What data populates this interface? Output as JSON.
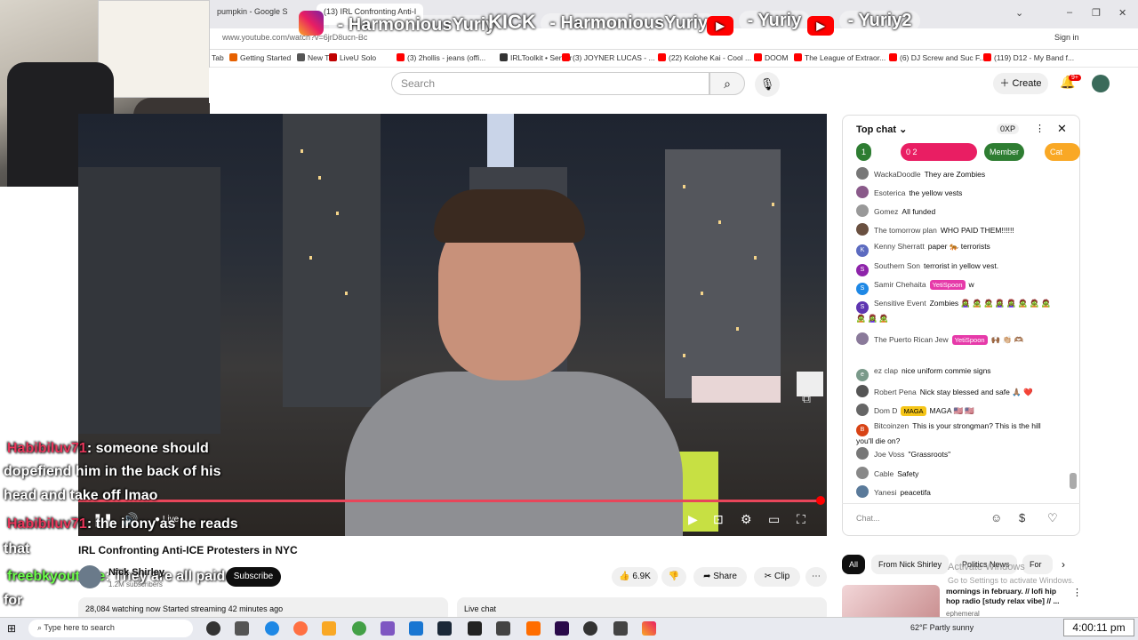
{
  "browser": {
    "tabs": [
      "pumpkin - Google S",
      "(13) IRL Confronting Anti-I"
    ],
    "url": "www.youtube.com/watch?v=6jrD8ucn-Bc",
    "sign_in": "Sign in",
    "bookmarks": [
      {
        "label": "Tab",
        "color": ""
      },
      {
        "label": "Getting Started",
        "color": "#e66000"
      },
      {
        "label": "New Tab",
        "color": "#555555"
      },
      {
        "label": "LiveU Solo",
        "color": "#c00000"
      },
      {
        "label": "(3) 2hollis - jeans (offi...",
        "color": "#ff0000"
      },
      {
        "label": "IRLToolkit • Server",
        "color": "#333333"
      },
      {
        "label": "(3) JOYNER LUCAS - ...",
        "color": "#ff0000"
      },
      {
        "label": "(22) Kolohe Kai - Cool ...",
        "color": "#ff0000"
      },
      {
        "label": "DOOM",
        "color": "#ff0000"
      },
      {
        "label": "The League of Extraor...",
        "color": "#ff0000"
      },
      {
        "label": "(6) DJ Screw and Suc F...",
        "color": "#ff0000"
      },
      {
        "label": "(119) D12 - My Band f...",
        "color": "#ff0000"
      }
    ]
  },
  "socials": [
    {
      "icon": "instagram-icon",
      "label": "- HarmoniousYuriy"
    },
    {
      "icon": "kick-icon",
      "brand": "KICK",
      "label": "- HarmoniousYuriy"
    },
    {
      "icon": "youtube-icon",
      "label": "- Yuriy"
    },
    {
      "icon": "youtube-icon",
      "label": "- Yuriy2"
    }
  ],
  "yt": {
    "search_placeholder": "Search",
    "create": "Create",
    "notif_count": "9+"
  },
  "video": {
    "title": "IRL Confronting Anti-ICE Protesters in NYC",
    "channel": "Nick Shirley",
    "subscribers": "1.2M subscribers",
    "subscribe": "Subscribe",
    "likes": "6.9K",
    "share": "Share",
    "clip": "Clip",
    "live": "Live",
    "watching": "28,084 watching now  Started streaming 42 minutes ago",
    "live_chat_label": "Live chat",
    "progress": 0.99
  },
  "overlay_chat": [
    {
      "user": "Habibiluv71",
      "text": ": someone should"
    },
    {
      "text": "dopefiend him in the back of his"
    },
    {
      "text": "head and take off lmao"
    },
    {
      "user": "Habibiluv71",
      "text": ": the irony as he reads"
    },
    {
      "text": "that"
    },
    {
      "user2": "freebkyoutube",
      "text": ": They are all paid"
    },
    {
      "text": "for"
    }
  ],
  "chat": {
    "header": "Top chat",
    "xp": "0XP",
    "chips": [
      {
        "label": "1",
        "color": "#2e7d32"
      },
      {
        "label": "0  2",
        "color": "#e91e63"
      },
      {
        "label": "Member",
        "color": "#2e7d32"
      },
      {
        "label": "Cat",
        "color": "#f9a825"
      }
    ],
    "messages": [
      {
        "author": "WackaDoodle",
        "text": "They are Zombies",
        "avatar_color": "#777777"
      },
      {
        "author": "Esoterica",
        "text": "the yellow vests",
        "avatar_color": "#8a5a8a"
      },
      {
        "author": "Gomez",
        "text": "All funded",
        "avatar_color": "#999999"
      },
      {
        "author": "The tomorrow plan",
        "text": "WHO PAID THEM!!!!!!",
        "avatar_color": "#6a5040"
      },
      {
        "author": "Kenny Sherratt",
        "text": "paper 🐅 terrorists",
        "avatar_color": "#5c6bc0",
        "avatar_letter": "K"
      },
      {
        "author": "Southern Son",
        "text": "terrorist in yellow vest.",
        "avatar_color": "#8e24aa",
        "avatar_letter": "S"
      },
      {
        "author": "Samir Chehaita",
        "badge": "YetiSpoon",
        "text": "w",
        "avatar_color": "#1e88e5",
        "avatar_letter": "S"
      },
      {
        "author": "Sensitive Event",
        "text": "Zombies 🧟‍♀️ 🧟 🧟 🧟‍♀️ 🧟‍♀️ 🧟 🧟 🧟 🧟 🧟‍♀️ 🧟",
        "avatar_color": "#5e35b1",
        "avatar_letter": "S"
      },
      {
        "author": "The Puerto Rican Jew",
        "badge": "YetiSpoon",
        "text": "🙌🏾 👏🏼 🫶🏽",
        "avatar_color": "#8a7a9a"
      },
      {
        "author": "ez clap",
        "text": "nice uniform commie signs",
        "avatar_color": "#7a9a8a",
        "avatar_letter": "e"
      },
      {
        "author": "Robert Pena",
        "text": "Nick stay blessed and safe 🙏🏽 ❤️",
        "avatar_color": "#555555"
      },
      {
        "author": "Dom D",
        "badge": "MAGA",
        "badge_type": "maga",
        "text": "MAGA 🇺🇸 🇺🇸",
        "avatar_color": "#666666"
      },
      {
        "author": "Bitcoinzen",
        "text": "This is your strongman? This is the hill you'll die on?",
        "avatar_color": "#d84315",
        "avatar_letter": "B"
      },
      {
        "author": "Joe Voss",
        "text": "\"Grassroots\"",
        "avatar_color": "#777777"
      },
      {
        "author": "Cable",
        "text": "Safety",
        "avatar_color": "#888888"
      },
      {
        "author": "Yanesi",
        "text": "peacetifa",
        "avatar_color": "#5a7a9a"
      }
    ],
    "input_placeholder": "Chat..."
  },
  "recs": {
    "tabs": [
      "All",
      "From Nick Shirley",
      "Politics News",
      "For"
    ],
    "title": "mornings in february. // lofi hip hop radio [study relax vibe] // ...",
    "channel": "ephemeral"
  },
  "windows": {
    "activate_title": "Activate Windows",
    "activate_sub": "Go to Settings to activate Windows.",
    "search_placeholder": "Type here to search",
    "weather": "62°F  Partly sunny",
    "clock": "4:00:11 pm"
  }
}
